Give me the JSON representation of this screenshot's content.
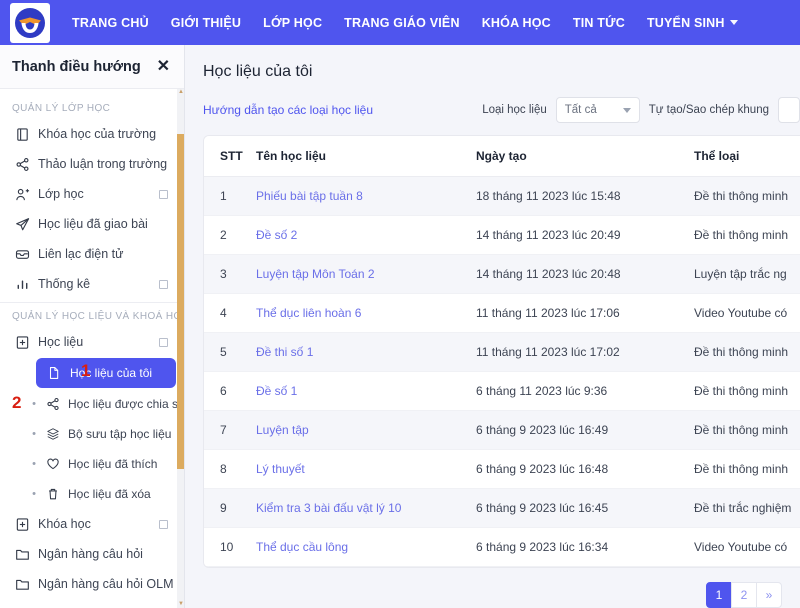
{
  "topnav": {
    "logo_icon": "olm-logo-icon",
    "links": [
      {
        "label": "TRANG CHỦ",
        "has_caret": false
      },
      {
        "label": "GIỚI THIỆU",
        "has_caret": false
      },
      {
        "label": "LỚP HỌC",
        "has_caret": false
      },
      {
        "label": "TRANG GIÁO VIÊN",
        "has_caret": false
      },
      {
        "label": "KHÓA HỌC",
        "has_caret": false
      },
      {
        "label": "TIN TỨC",
        "has_caret": false
      },
      {
        "label": "TUYỂN SINH",
        "has_caret": true
      }
    ]
  },
  "sidebar": {
    "title": "Thanh điều hướng",
    "close_icon": "close-icon",
    "section_1_label": "QUẢN LÝ LỚP HỌC",
    "section_2_label": "QUẢN LÝ HỌC LIỆU VÀ KHOÁ HỌC",
    "group1": [
      {
        "label": "Khóa học của trường",
        "icon": "book-icon",
        "expandable": false
      },
      {
        "label": "Thảo luận trong trường",
        "icon": "share-nodes-icon",
        "expandable": false
      },
      {
        "label": "Lớp học",
        "icon": "user-plus-icon",
        "expandable": true
      },
      {
        "label": "Học liệu đã giao bài",
        "icon": "paper-plane-icon",
        "expandable": false
      },
      {
        "label": "Liên lạc điện tử",
        "icon": "inbox-icon",
        "expandable": false
      },
      {
        "label": "Thống kê",
        "icon": "bar-chart-icon",
        "expandable": true
      }
    ],
    "hoclieu": {
      "label": "Học liệu",
      "icon": "file-plus-icon",
      "expandable": true
    },
    "active_item": {
      "label": "Học liệu của tôi",
      "icon": "file-icon"
    },
    "sub_items": [
      {
        "label": "Học liệu được chia sẻ",
        "icon": "share-nodes-icon"
      },
      {
        "label": "Bộ sưu tập học liệu",
        "icon": "layers-icon"
      },
      {
        "label": "Học liệu đã thích",
        "icon": "heart-icon"
      },
      {
        "label": "Học liệu đã xóa",
        "icon": "trash-icon"
      }
    ],
    "group3": [
      {
        "label": "Khóa học",
        "icon": "file-plus-icon",
        "expandable": true
      },
      {
        "label": "Ngân hàng câu hỏi",
        "icon": "folder-icon",
        "expandable": false
      },
      {
        "label": "Ngân hàng câu hỏi OLM",
        "icon": "folder-icon",
        "expandable": false
      }
    ],
    "markers": [
      {
        "text": "1"
      },
      {
        "text": "2"
      }
    ],
    "scrollbar_color": "#dcab5f"
  },
  "main": {
    "page_title": "Học liệu của tôi",
    "guide_link": "Hướng dẫn tạo các loại học liệu",
    "filters": {
      "type_label": "Loại học liệu",
      "type_value": "Tất cả",
      "source_label": "Tự tạo/Sao chép khung"
    },
    "table": {
      "headers": [
        "STT",
        "Tên học liệu",
        "Ngày tạo",
        "Thể loại"
      ],
      "rows": [
        {
          "stt": "1",
          "name": "Phiếu bài tập tuần 8",
          "date": "18 tháng 11 2023 lúc 15:48",
          "type": "Đề thi thông minh"
        },
        {
          "stt": "2",
          "name": "Đề số 2",
          "date": "14 tháng 11 2023 lúc 20:49",
          "type": "Đề thi thông minh"
        },
        {
          "stt": "3",
          "name": "Luyện tập Môn Toán 2",
          "date": "14 tháng 11 2023 lúc 20:48",
          "type": "Luyện tập trắc ng"
        },
        {
          "stt": "4",
          "name": "Thể dục liên hoàn 6",
          "date": "11 tháng 11 2023 lúc 17:06",
          "type": "Video Youtube có"
        },
        {
          "stt": "5",
          "name": "Đề thi số 1",
          "date": "11 tháng 11 2023 lúc 17:02",
          "type": "Đề thi thông minh"
        },
        {
          "stt": "6",
          "name": "Đề số 1",
          "date": "6 tháng 11 2023 lúc 9:36",
          "type": "Đề thi thông minh"
        },
        {
          "stt": "7",
          "name": "Luyện tập",
          "date": "6 tháng 9 2023 lúc 16:49",
          "type": "Đề thi thông minh"
        },
        {
          "stt": "8",
          "name": "Lý thuyết",
          "date": "6 tháng 9 2023 lúc 16:48",
          "type": "Đề thi thông minh"
        },
        {
          "stt": "9",
          "name": "Kiểm tra 3 bài đấu vật lý 10",
          "date": "6 tháng 9 2023 lúc 16:45",
          "type": "Đề thi trắc nghiệm"
        },
        {
          "stt": "10",
          "name": "Thể dục cầu lông",
          "date": "6 tháng 9 2023 lúc 16:34",
          "type": "Video Youtube có"
        }
      ]
    },
    "pagination": {
      "pages": [
        "1",
        "2"
      ],
      "next_label": "»",
      "current": "1"
    }
  },
  "colors": {
    "brand": "#4f55ee",
    "link": "#6a6fe8",
    "accent_orange": "#f0962e",
    "marker_red": "#d91f11",
    "page_bg": "#f4f5fa"
  }
}
